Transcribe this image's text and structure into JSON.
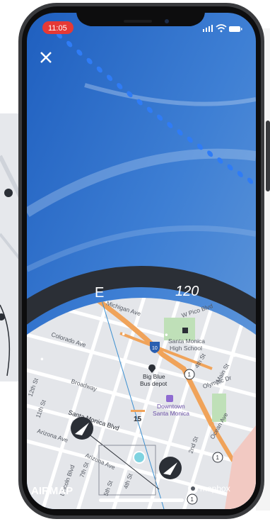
{
  "status_bar": {
    "time": "11:05",
    "signal_icon": "cellular-bars-icon",
    "wifi_icon": "wifi-icon",
    "battery_icon": "battery-icon"
  },
  "camera_view": {
    "close_icon": "close-icon",
    "flight_path_color": "#2f7cf6",
    "sky_color": "#2f6fc9"
  },
  "compass": {
    "heading_label": "E",
    "bearing_label": "120",
    "ring_color": "#2b2f36"
  },
  "map": {
    "labels": {
      "pico": "W Pico Blvd",
      "michigan": "Michigan Ave",
      "colorado": "Colorado Ave",
      "high_school_1": "Santa Monica",
      "high_school_2": "High School",
      "depot_1": "Big Blue",
      "depot_2": "Bus depot",
      "broadway": "Broadway",
      "olympic": "Olympic Dr",
      "main_st": "Main St",
      "fourth_st": "4th St",
      "downtown_1": "Downtown",
      "downtown_2": "Santa Monica",
      "eleventh": "11th St",
      "twelfth": "12th St",
      "santa_monica_blvd": "Santa Monica Blvd",
      "arizona_1": "Arizona Ave",
      "arizona_2": "Arizona Ave",
      "ocean": "Ocean Ave",
      "second": "2nd St",
      "fifth": "5th St",
      "fourth_lower": "4th St",
      "seventh": "7th St",
      "lincoln": "Lincoln Blvd",
      "interstate_10": "10",
      "route_1a": "1",
      "route_1b": "1",
      "route_1c": "1",
      "route_15": "15"
    },
    "brand_left": "AIRMAP",
    "brand_right": "mapbox",
    "water_color": "#f2c9c2"
  }
}
